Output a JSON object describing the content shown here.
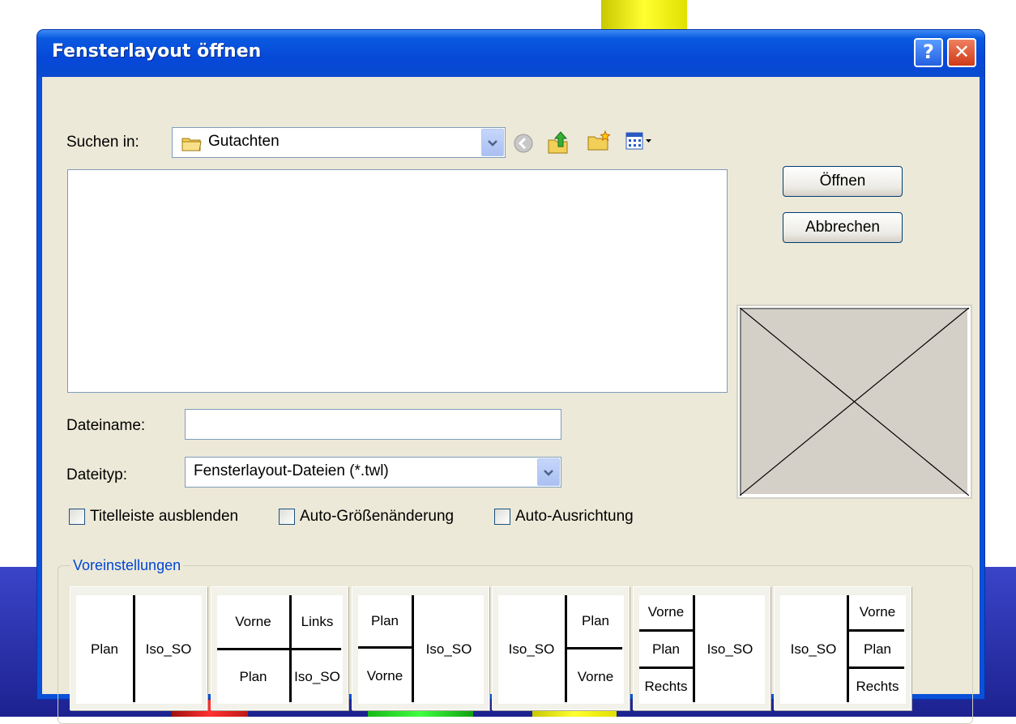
{
  "dialog": {
    "title": "Fensterlayout öffnen",
    "help_glyph": "?",
    "close_glyph": "✕"
  },
  "look_in": {
    "label": "Suchen in:",
    "value": "Gutachten"
  },
  "file_name": {
    "label": "Dateiname:",
    "value": ""
  },
  "file_type": {
    "label": "Dateityp:",
    "value": "Fensterlayout-Dateien  (*.twl)"
  },
  "buttons": {
    "open": "Öffnen",
    "cancel": "Abbrechen"
  },
  "checkboxes": [
    {
      "label": "Titelleiste ausblenden",
      "checked": false
    },
    {
      "label": "Auto-Größenänderung",
      "checked": false
    },
    {
      "label": "Auto-Ausrichtung",
      "checked": false
    }
  ],
  "presets": {
    "legend": "Voreinstellungen",
    "items": [
      {
        "cells": [
          "Plan",
          "Iso_SO"
        ]
      },
      {
        "cells": [
          "Vorne",
          "Links",
          "Plan",
          "Iso_SO"
        ]
      },
      {
        "cells": [
          "Plan",
          "Vorne",
          "Iso_SO"
        ]
      },
      {
        "cells": [
          "Iso_SO",
          "Plan",
          "Vorne"
        ]
      },
      {
        "cells": [
          "Vorne",
          "Plan",
          "Rechts",
          "Iso_SO"
        ]
      },
      {
        "cells": [
          "Iso_SO",
          "Vorne",
          "Plan",
          "Rechts"
        ]
      }
    ]
  },
  "colors": {
    "title_bar": "#0a5ae0",
    "dialog_face": "#ece9d8",
    "background_blue": "#2a33b0",
    "accent_yellow": "#f2f000",
    "accent_red": "#e02020",
    "accent_green": "#22dd22"
  }
}
